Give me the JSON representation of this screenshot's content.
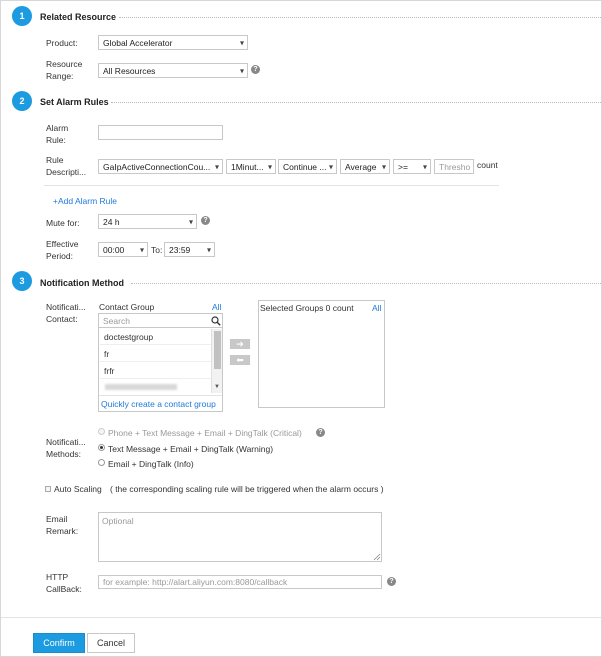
{
  "section1": {
    "step": "1",
    "title": "Related Resource",
    "product_label": "Product:",
    "product_value": "Global Accelerator",
    "range_label_1": "Resource",
    "range_label_2": "Range:",
    "range_value": "All Resources"
  },
  "section2": {
    "step": "2",
    "title": "Set Alarm Rules",
    "rule_label_1": "Alarm",
    "rule_label_2": "Rule:",
    "rule_value": "",
    "desc_label_1": "Rule",
    "desc_label_2": "Descripti...",
    "metric": "GaIpActiveConnectionCou...",
    "period": "1Minut...",
    "continue": "Continue ...",
    "statistic": "Average",
    "operator": ">=",
    "threshold_placeholder": "Thresho",
    "unit": "count",
    "add_rule": "+Add Alarm Rule",
    "mute_label": "Mute for:",
    "mute_value": "24 h",
    "period_label_1": "Effective",
    "period_label_2": "Period:",
    "start_time": "00:00",
    "to_label": "To:",
    "end_time": "23:59"
  },
  "section3": {
    "step": "3",
    "title": "Notification Method",
    "contact_label_1": "Notificati...",
    "contact_label_2": "Contact:",
    "group_header": "Contact Group",
    "all_link": "All",
    "search_placeholder": "Search",
    "groups": [
      "doctestgroup",
      "fr",
      "frfr"
    ],
    "quick_create": "Quickly create a contact group",
    "selected_header": "Selected Groups 0 count",
    "selected_all": "All",
    "methods_label_1": "Notificati...",
    "methods_label_2": "Methods:",
    "methods": [
      "Phone + Text Message + Email + DingTalk (Critical)",
      "Text Message + Email + DingTalk (Warning)",
      "Email + DingTalk (Info)"
    ],
    "auto_scaling_label": "Auto Scaling",
    "auto_scaling_desc": "( the corresponding scaling rule will be triggered when the alarm occurs )",
    "remark_label_1": "Email",
    "remark_label_2": "Remark:",
    "remark_placeholder": "Optional",
    "callback_label_1": "HTTP",
    "callback_label_2": "CallBack:",
    "callback_placeholder": "for example: http://alart.aliyun.com:8080/callback"
  },
  "footer": {
    "confirm": "Confirm",
    "cancel": "Cancel"
  },
  "colors": {
    "accent": "#1d9be0",
    "link": "#1d7ad8"
  }
}
